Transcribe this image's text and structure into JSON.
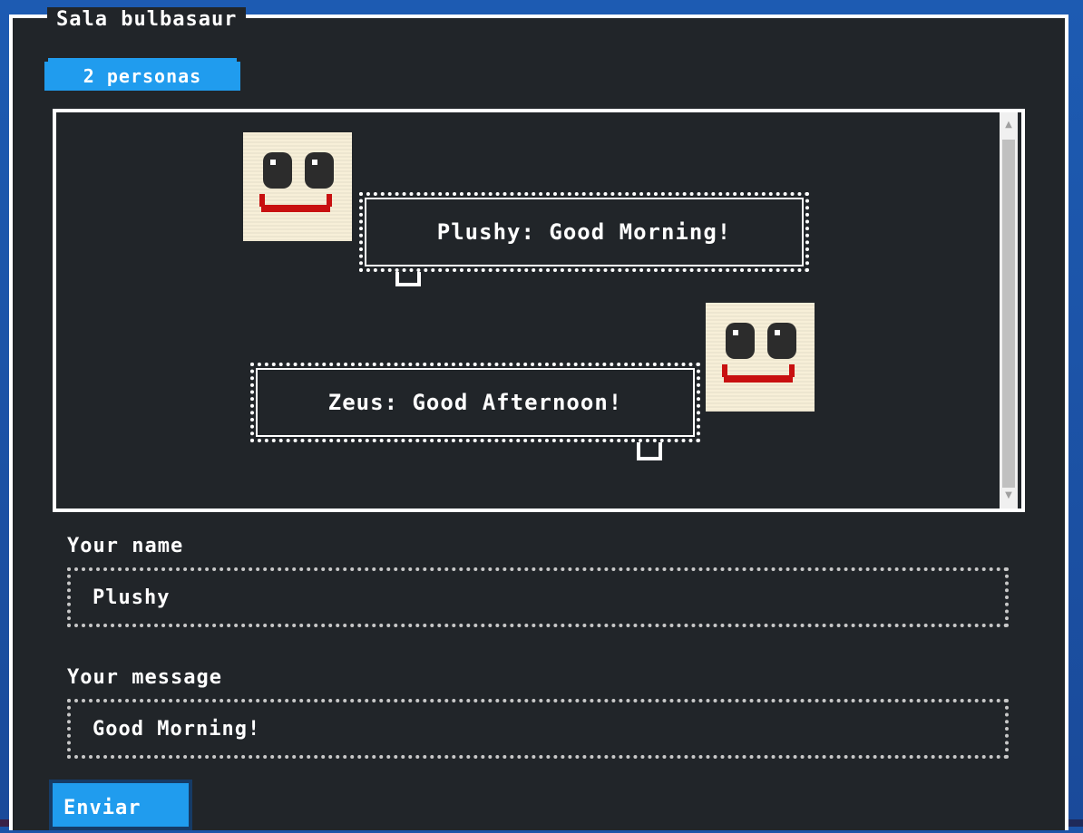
{
  "room": {
    "title": "Sala bulbasaur",
    "people_badge": "2 personas"
  },
  "messages": [
    {
      "author": "Plushy",
      "text": "Plushy: Good Morning!",
      "avatar_icon": "smiley-face-icon",
      "side": "left"
    },
    {
      "author": "Zeus",
      "text": "Zeus: Good Afternoon!",
      "avatar_icon": "smiley-face-icon",
      "side": "right"
    }
  ],
  "form": {
    "name_label": "Your name",
    "name_value": "Plushy",
    "message_label": "Your message",
    "message_value": "Good Morning!",
    "send_label": "Enviar"
  },
  "colors": {
    "panel_bg": "#212529",
    "accent": "#209cee",
    "avatar_skin": "#f7efd8",
    "mouth": "#c81010",
    "page_bg": "#1c54a8"
  }
}
